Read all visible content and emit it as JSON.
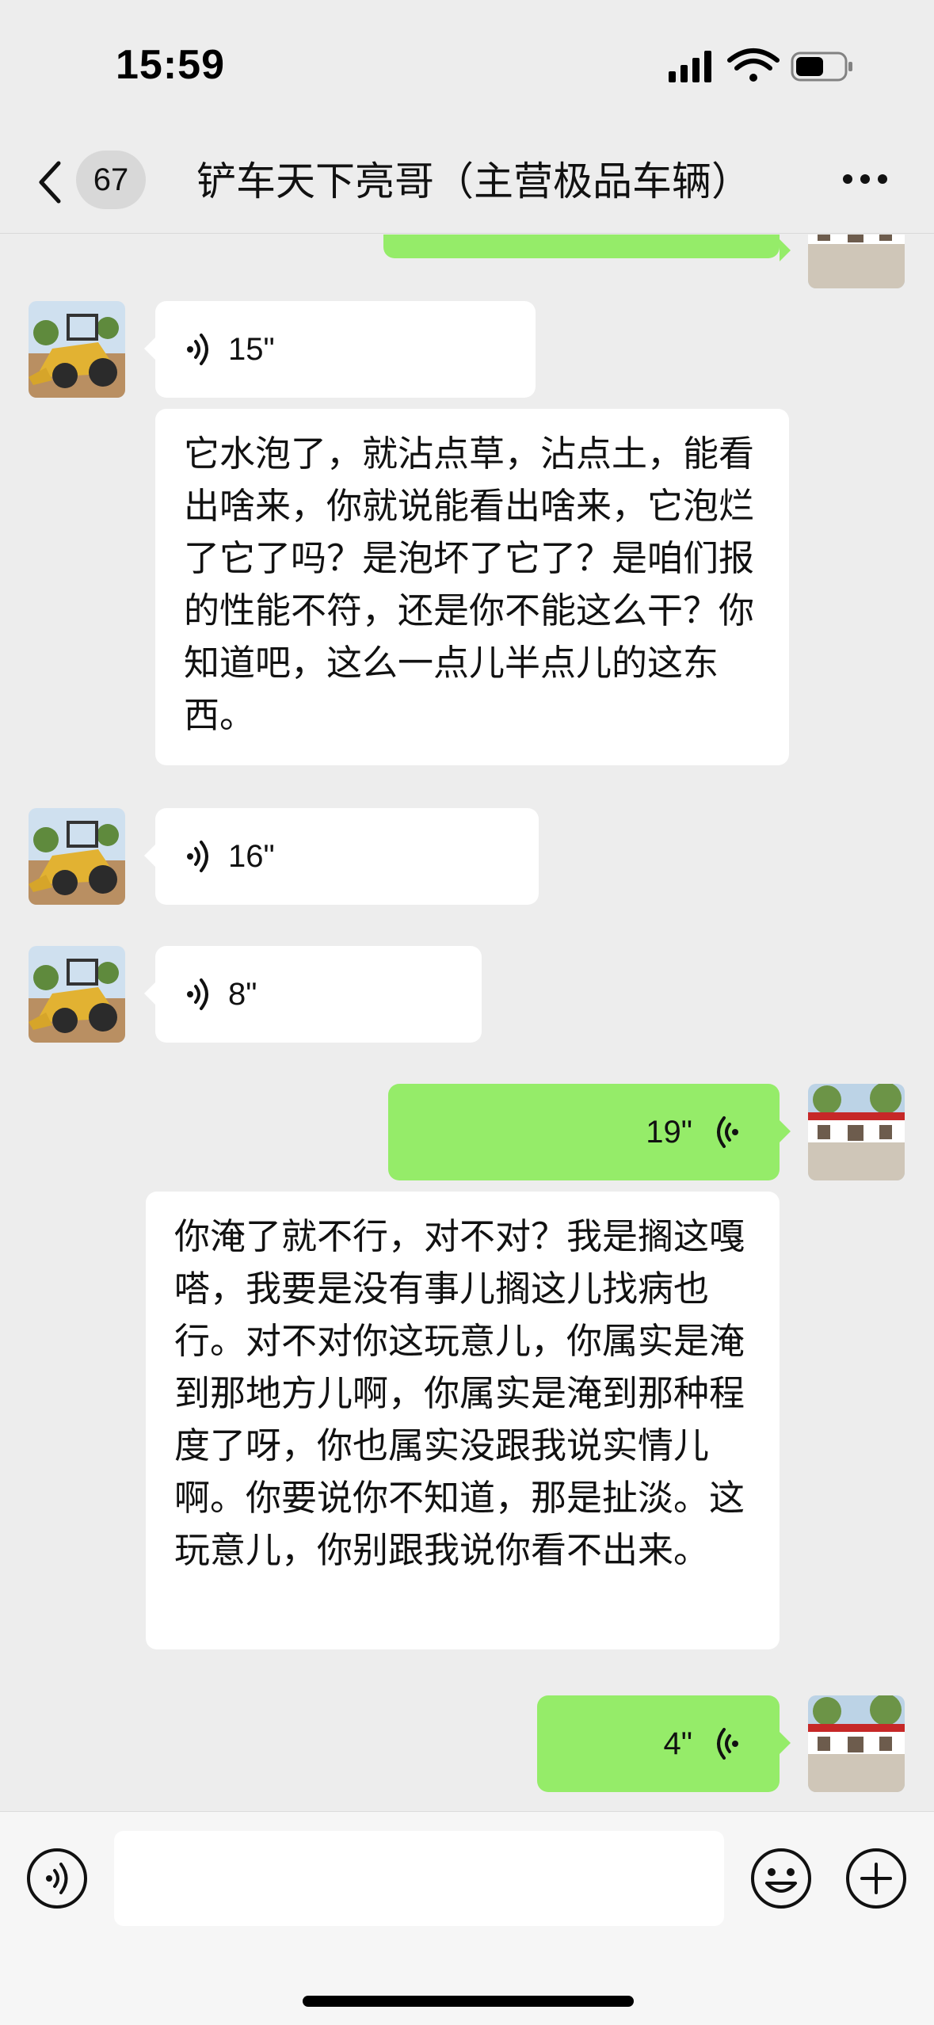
{
  "status_bar": {
    "time": "15:59"
  },
  "nav": {
    "unread_count": "67",
    "title": "铲车天下亮哥（主营极品车辆）"
  },
  "messages": [
    {
      "side": "in",
      "type": "voice",
      "duration": "15\""
    },
    {
      "side": "in",
      "type": "transcript",
      "text": "它水泡了，就沾点草，沾点土，能看出啥来，你就说能看出啥来，它泡烂了它了吗？是泡坏了它了？是咱们报的性能不符，还是你不能这么干？你知道吧，这么一点儿半点儿的这东西。"
    },
    {
      "side": "in",
      "type": "voice",
      "duration": "16\""
    },
    {
      "side": "in",
      "type": "voice",
      "duration": "8\""
    },
    {
      "side": "out",
      "type": "voice",
      "duration": "19\""
    },
    {
      "side": "out",
      "type": "transcript",
      "text": "你淹了就不行，对不对？我是搁这嘎嗒，我要是没有事儿搁这儿找病也行。对不对你这玩意儿，你属实是淹到那地方儿啊，你属实是淹到那种程度了呀，你也属实没跟我说实情儿啊。你要说你不知道，那是扯淡。这玩意儿，你别跟我说你看不出来。"
    },
    {
      "side": "out",
      "type": "voice",
      "duration": "4\""
    }
  ],
  "colors": {
    "background": "#ededed",
    "outgoing_bubble": "#95ec69",
    "incoming_bubble": "#ffffff"
  },
  "icons": {
    "voice_mode": "voice-mode-icon",
    "emoji": "emoji-icon",
    "more": "plus-icon",
    "back": "chevron-left-icon",
    "menu": "more-dots-icon"
  }
}
